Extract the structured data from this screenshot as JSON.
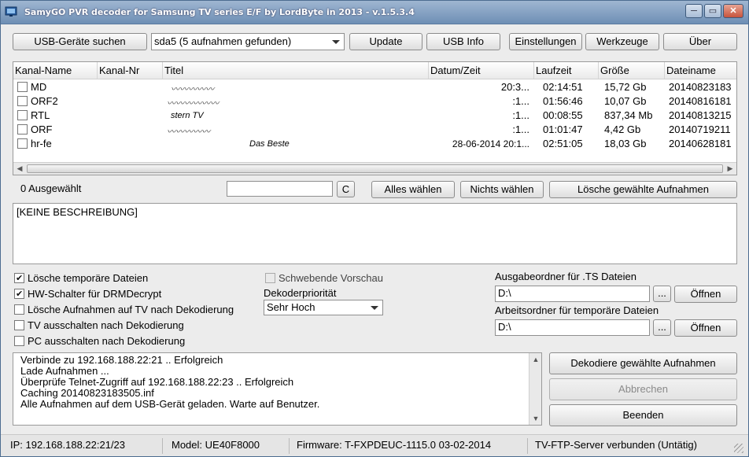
{
  "window": {
    "title": "SamyGO PVR decoder for Samsung TV series E/F by LordByte in 2013 - v.1.5.3.4",
    "minimize": "─",
    "restore": "▭",
    "close": "✕"
  },
  "toolbar": {
    "usb_search": "USB-Geräte suchen",
    "drive_select": "sda5  (5 aufnahmen gefunden)",
    "update": "Update",
    "usb_info": "USB Info",
    "settings": "Einstellungen",
    "tools": "Werkzeuge",
    "about": "Über"
  },
  "recordings": {
    "columns": [
      "Kanal-Name",
      "Kanal-Nr",
      "Titel",
      "Datum/Zeit",
      "Laufzeit",
      "Größe",
      "Dateiname"
    ],
    "rows": [
      {
        "channel": "MD",
        "nr": "",
        "title": "",
        "date": "20:3...",
        "duration": "02:14:51",
        "size": "15,72 Gb",
        "file": "20140823183"
      },
      {
        "channel": "ORF2",
        "nr": "",
        "title": "",
        "date": ":1...",
        "duration": "01:56:46",
        "size": "10,07 Gb",
        "file": "20140816181"
      },
      {
        "channel": "RTL",
        "nr": "",
        "title": "stern TV",
        "date": ":1...",
        "duration": "00:08:55",
        "size": "837,34 Mb",
        "file": "20140813215"
      },
      {
        "channel": "ORF",
        "nr": "",
        "title": "",
        "date": ":1...",
        "duration": "01:01:47",
        "size": "4,42 Gb",
        "file": "20140719211"
      },
      {
        "channel": "hr-fe",
        "nr": "",
        "title": "Das Beste",
        "date": "28-06-2014 20:1...",
        "duration": "02:51:05",
        "size": "18,03 Gb",
        "file": "20140628181"
      }
    ]
  },
  "selection": {
    "count_text": "0 Ausgewählt",
    "filter_value": "",
    "clear_label": "C",
    "select_all": "Alles wählen",
    "select_none": "Nichts wählen",
    "delete_selected": "Lösche gewählte Aufnahmen"
  },
  "description": {
    "text": "[KEINE BESCHREIBUNG]"
  },
  "options": {
    "delete_temp": {
      "label": "Lösche temporäre Dateien",
      "checked": true
    },
    "hw_drm": {
      "label": "HW-Schalter für DRMDecrypt",
      "checked": true
    },
    "delete_on_tv": {
      "label": "Lösche Aufnahmen auf TV nach Dekodierung",
      "checked": false
    },
    "tv_off": {
      "label": "TV ausschalten nach Dekodierung",
      "checked": false
    },
    "pc_off": {
      "label": "PC ausschalten nach Dekodierung",
      "checked": false
    },
    "floating_preview": {
      "label": "Schwebende Vorschau",
      "checked": false
    },
    "priority_label": "Dekoderpriorität",
    "priority_value": "Sehr Hoch"
  },
  "folders": {
    "output_label": "Ausgabeordner für .TS Dateien",
    "output_value": "D:\\",
    "work_label": "Arbeitsordner für temporäre Dateien",
    "work_value": "D:\\",
    "browse": "...",
    "open": "Öffnen"
  },
  "log": {
    "lines": [
      "Verbinde zu 192.168.188.22:21 .. Erfolgreich",
      "Lade Aufnahmen ...",
      "Überprüfe Telnet-Zugriff auf 192.168.188.22:23 .. Erfolgreich",
      "Caching 20140823183505.inf",
      "Alle Aufnahmen auf dem USB-Gerät geladen. Warte auf Benutzer."
    ]
  },
  "actions": {
    "decode": "Dekodiere gewählte Aufnahmen",
    "cancel": "Abbrechen",
    "exit": "Beenden"
  },
  "status": {
    "ip": "IP: 192.168.188.22:21/23",
    "model": "Model: UE40F8000",
    "firmware": "Firmware: T-FXPDEUC-1115.0  03-02-2014",
    "ftp": "TV-FTP-Server verbunden (Untätig)"
  }
}
